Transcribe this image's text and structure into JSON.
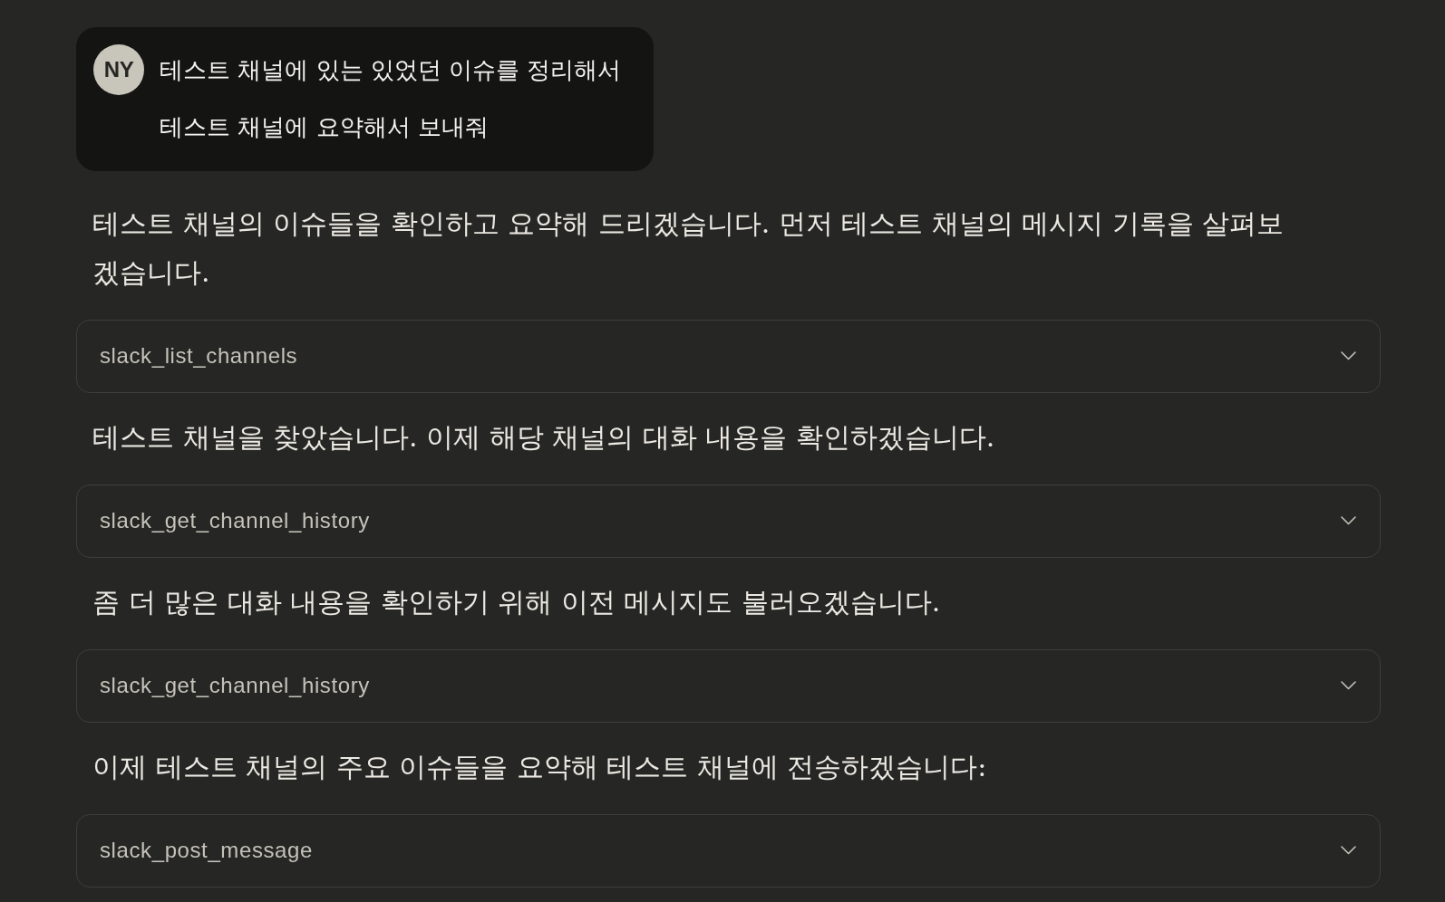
{
  "user_message": {
    "avatar": "NY",
    "text": "테스트 채널에 있는 있었던 이슈를 정리해서 테스트 채널에 요약해서 보내줘"
  },
  "assistant_turn": [
    {
      "kind": "text",
      "text": "테스트 채널의 이슈들을 확인하고 요약해 드리겠습니다. 먼저 테스트 채널의 메시지 기록을 살펴보겠습니다."
    },
    {
      "kind": "tool_call",
      "name": "slack_list_channels",
      "expanded": false
    },
    {
      "kind": "text",
      "text": "테스트 채널을 찾았습니다. 이제 해당 채널의 대화 내용을 확인하겠습니다."
    },
    {
      "kind": "tool_call",
      "name": "slack_get_channel_history",
      "expanded": false
    },
    {
      "kind": "text",
      "text": "좀 더 많은 대화 내용을 확인하기 위해 이전 메시지도 불러오겠습니다."
    },
    {
      "kind": "tool_call",
      "name": "slack_get_channel_history",
      "expanded": false
    },
    {
      "kind": "text",
      "text": "이제 테스트 채널의 주요 이슈들을 요약해 테스트 채널에 전송하겠습니다:"
    },
    {
      "kind": "tool_call",
      "name": "slack_post_message",
      "expanded": false
    }
  ]
}
